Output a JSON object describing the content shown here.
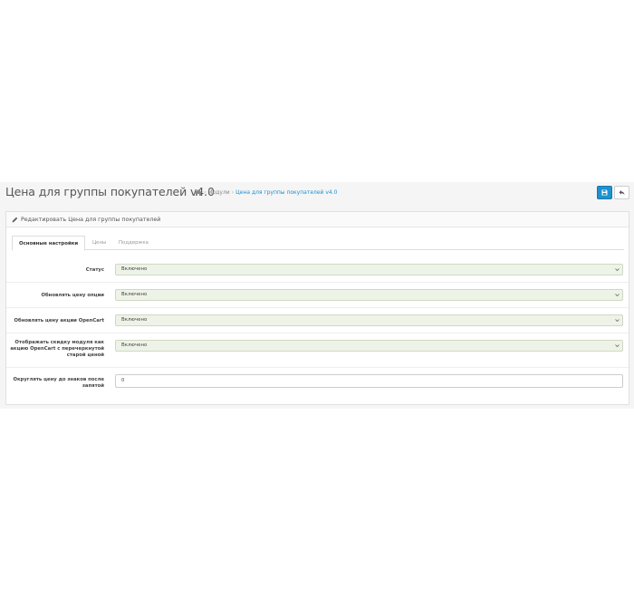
{
  "header": {
    "title": "Цена для группы покупателей v4.0",
    "breadcrumb": {
      "home_icon": "home-icon",
      "items": [
        "Модули",
        "Цена для группы покупателей v4.0"
      ]
    },
    "save_icon": "save-icon",
    "back_icon": "reply-icon"
  },
  "panel": {
    "heading": "Редактировать Цена для группы покупателей",
    "heading_icon": "pencil-icon"
  },
  "tabs": [
    {
      "label": "Основные настройки",
      "active": true
    },
    {
      "label": "Цены",
      "active": false
    },
    {
      "label": "Поддержка",
      "active": false
    }
  ],
  "form": {
    "status": {
      "label": "Статус",
      "value": "Включено"
    },
    "option_price": {
      "label": "Обновлять цену опции",
      "value": "Включено"
    },
    "special_price": {
      "label": "Обновлять цену акции OpenCart",
      "value": "Включено"
    },
    "display_discount": {
      "label_lines": [
        "Отображать скидку модуля как",
        "акцию OpenCart с перечеркнутой",
        "старой ценой"
      ],
      "value": "Включено"
    },
    "rounding": {
      "label_lines": [
        "Округлять цену до знаков после",
        "запятой"
      ],
      "value": "0"
    }
  },
  "colors": {
    "accent": "#1e91cf",
    "select_bg": "#eef3e8"
  }
}
